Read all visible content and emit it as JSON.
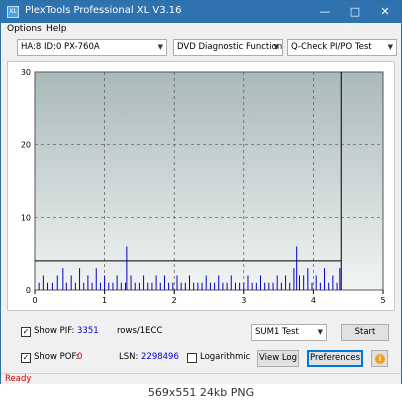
{
  "window": {
    "title": "PlexTools Professional XL V3.16",
    "icon_label": "XL",
    "minimize_icon": "minimize-icon",
    "maximize_icon": "maximize-icon",
    "close_icon": "close-icon"
  },
  "menu": {
    "options": "Options",
    "help": "Help"
  },
  "toolbar": {
    "drive": "HA:8 ID:0  PX-760A",
    "function": "DVD Diagnostic Functions",
    "test": "Q-Check PI/PO Test"
  },
  "chart_data": {
    "type": "bar",
    "x_ticks": [
      "0",
      "1",
      "2",
      "3",
      "4",
      "5"
    ],
    "y_ticks": [
      "0",
      "10",
      "20",
      "30"
    ],
    "xlim": [
      0,
      5
    ],
    "ylim": [
      0,
      30
    ],
    "grid": true,
    "threshold_line": 4,
    "end_marker_x": 4.4,
    "bar_color": "#0000cc",
    "background_top": "#a9b9b9",
    "background_bottom": "#f2f4f4",
    "bars": [
      [
        0.06,
        1
      ],
      [
        0.12,
        2
      ],
      [
        0.18,
        1
      ],
      [
        0.25,
        1
      ],
      [
        0.32,
        2
      ],
      [
        0.4,
        3
      ],
      [
        0.45,
        1
      ],
      [
        0.52,
        2
      ],
      [
        0.58,
        1
      ],
      [
        0.64,
        3
      ],
      [
        0.7,
        1
      ],
      [
        0.76,
        2
      ],
      [
        0.82,
        1
      ],
      [
        0.88,
        3
      ],
      [
        0.94,
        1
      ],
      [
        1.0,
        2
      ],
      [
        1.06,
        1
      ],
      [
        1.12,
        1
      ],
      [
        1.18,
        2
      ],
      [
        1.24,
        1
      ],
      [
        1.3,
        1
      ],
      [
        1.32,
        6
      ],
      [
        1.38,
        2
      ],
      [
        1.44,
        1
      ],
      [
        1.5,
        1
      ],
      [
        1.56,
        2
      ],
      [
        1.62,
        1
      ],
      [
        1.68,
        1
      ],
      [
        1.74,
        2
      ],
      [
        1.8,
        1
      ],
      [
        1.86,
        2
      ],
      [
        1.92,
        1
      ],
      [
        1.98,
        1
      ],
      [
        2.04,
        2
      ],
      [
        2.1,
        1
      ],
      [
        2.16,
        1
      ],
      [
        2.22,
        2
      ],
      [
        2.28,
        1
      ],
      [
        2.34,
        1
      ],
      [
        2.4,
        1
      ],
      [
        2.46,
        2
      ],
      [
        2.52,
        1
      ],
      [
        2.58,
        1
      ],
      [
        2.64,
        2
      ],
      [
        2.7,
        1
      ],
      [
        2.76,
        1
      ],
      [
        2.82,
        2
      ],
      [
        2.88,
        1
      ],
      [
        2.94,
        1
      ],
      [
        3.0,
        1
      ],
      [
        3.06,
        2
      ],
      [
        3.12,
        1
      ],
      [
        3.18,
        1
      ],
      [
        3.24,
        2
      ],
      [
        3.3,
        1
      ],
      [
        3.36,
        1
      ],
      [
        3.42,
        1
      ],
      [
        3.48,
        2
      ],
      [
        3.54,
        1
      ],
      [
        3.6,
        2
      ],
      [
        3.66,
        1
      ],
      [
        3.72,
        3
      ],
      [
        3.76,
        6
      ],
      [
        3.8,
        2
      ],
      [
        3.86,
        2
      ],
      [
        3.92,
        3
      ],
      [
        3.98,
        1
      ],
      [
        4.04,
        2
      ],
      [
        4.1,
        1
      ],
      [
        4.16,
        3
      ],
      [
        4.22,
        1
      ],
      [
        4.28,
        2
      ],
      [
        4.34,
        1
      ],
      [
        4.38,
        3
      ]
    ]
  },
  "controls": {
    "show_pif_label": "Show PIF:",
    "pif_value": "3351",
    "pif_unit": "rows/1ECC",
    "show_pof_label": "Show POF:",
    "pof_value": "0",
    "lsn_label": "LSN:",
    "lsn_value": "2298496",
    "logarithmic_label": "Logarithmic",
    "sum_select": "SUM1 Test",
    "start_label": "Start",
    "view_log_label": "View Log",
    "preferences_label": "Preferences",
    "pif_value_color": "#0000cc",
    "pof_value_color": "#cc0000",
    "lsn_value_color": "#0000cc"
  },
  "status": {
    "text": "Ready",
    "color": "#cc0000"
  },
  "footer": {
    "caption": "569x551  24kb  PNG"
  }
}
